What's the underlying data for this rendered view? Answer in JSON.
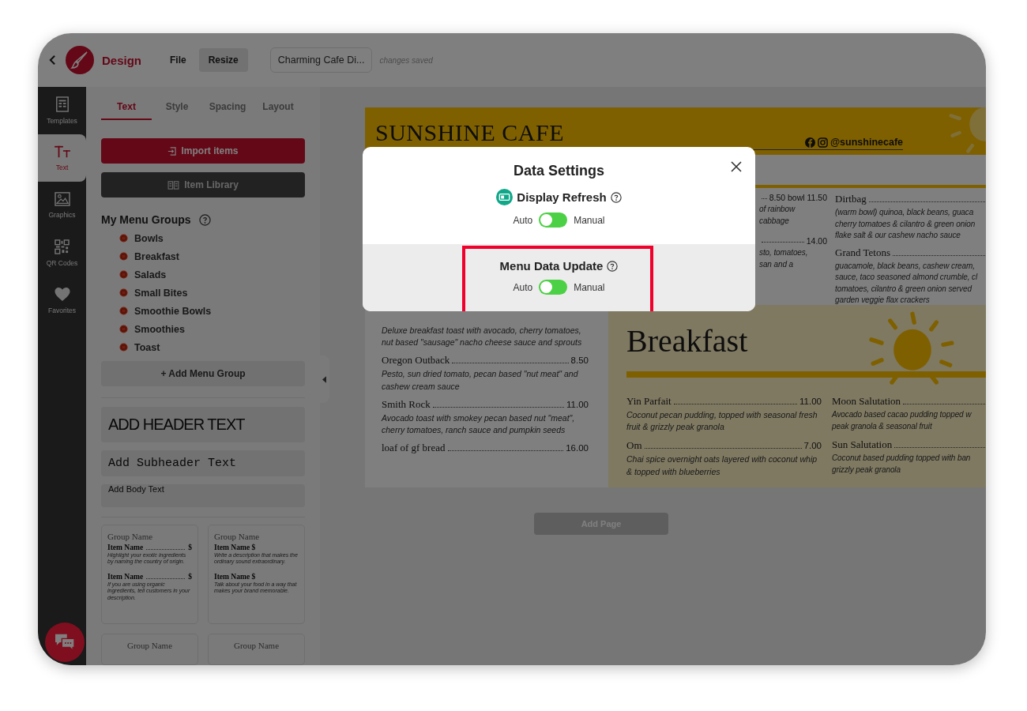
{
  "top_bar": {
    "title": "Design",
    "menu": [
      {
        "label": "File",
        "kind": "plain"
      },
      {
        "label": "Resize",
        "kind": "filled"
      }
    ],
    "document_name": "Charming Cafe Di...",
    "save_status": "changes saved"
  },
  "rail": [
    {
      "label": "Templates",
      "selected": false
    },
    {
      "label": "Text",
      "selected": true
    },
    {
      "label": "Graphics",
      "selected": false
    },
    {
      "label": "QR Codes",
      "selected": false
    },
    {
      "label": "Favorites",
      "selected": false
    }
  ],
  "panel": {
    "tabs": [
      {
        "label": "Text",
        "selected": true
      },
      {
        "label": "Style",
        "selected": false
      },
      {
        "label": "Spacing",
        "selected": false
      },
      {
        "label": "Layout",
        "selected": false
      }
    ],
    "import_button": "Import items",
    "library_button": "Item Library",
    "groups_title": "My Menu Groups",
    "groups": [
      "Bowls",
      "Breakfast",
      "Salads",
      "Small Bites",
      "Smoothie Bowls",
      "Smoothies",
      "Toast"
    ],
    "add_group": "+ Add Menu Group",
    "text_styles": [
      {
        "kind": "header",
        "label": "ADD HEADER TEXT"
      },
      {
        "kind": "subheader",
        "label": "Add Subheader Text"
      },
      {
        "kind": "body",
        "label": "Add Body Text"
      }
    ],
    "templates": [
      {
        "kind": "leader",
        "title": "Group Name",
        "items": [
          {
            "name": "Item Name",
            "price": "$",
            "description": "Highlight your exotic ingredients by naming the country of origin."
          },
          {
            "name": "Item Name",
            "price": "$",
            "description": "If you are using organic ingredients, tell customers in your description."
          }
        ]
      },
      {
        "kind": "inline",
        "title": "Group Name",
        "items": [
          {
            "name": "Item Name $",
            "description": "Write a description that makes the ordinary sound extraordinary."
          },
          {
            "name": "Item Name $",
            "description": "Talk about your food in a way that makes your brand memorable."
          }
        ]
      },
      {
        "kind": "title_only",
        "title": "Group Name"
      },
      {
        "kind": "title_only",
        "title": "Group Name"
      }
    ]
  },
  "menu": {
    "title": "SUNSHINE CAFE",
    "handle": "@sunshinecafe",
    "left_items": [
      {
        "description": "Deluxe breakfast toast with avocado, cherry tomatoes, nut based \"sausage\" nacho cheese sauce and sprouts"
      },
      {
        "name": "Oregon Outback",
        "price": "8.50",
        "description": "Pesto, sun dried tomato, pecan based \"nut meat\" and cashew cream sauce"
      },
      {
        "name": "Smith Rock",
        "price": "11.00",
        "description": "Avocado toast with smokey pecan based nut \"meat\", cherry tomatoes, ranch sauce and pumpkin seeds"
      },
      {
        "name": "loaf of gf bread",
        "price": "16.00"
      }
    ],
    "middle_fragments": [
      {
        "kind": "price",
        "text": "8.50  bowl 11.50"
      },
      {
        "kind": "text",
        "lines": [
          "of rainbow",
          "cabbage"
        ]
      },
      {
        "kind": "price",
        "text": "14.00"
      },
      {
        "kind": "text",
        "lines": [
          "sto, tomatoes,",
          "san and a"
        ]
      }
    ],
    "right_items": [
      {
        "name": "Dirtbag",
        "lines": [
          "(warm bowl) quinoa, black beans, guaca",
          "cherry tomatoes & cilantro & green onion",
          "flake salt & our cashew nacho sauce"
        ]
      },
      {
        "name": "Grand Tetons",
        "lines": [
          "guacamole, black beans, cashew cream,",
          "sauce, taco seasoned almond crumble, cl",
          "tomatoes, cilantro & green onion served",
          "garden veggie flax crackers"
        ]
      }
    ],
    "section_title": "Breakfast",
    "breakfast_left": [
      {
        "name": "Yin Parfait",
        "price": "11.00",
        "description": "Coconut pecan pudding, topped with seasonal fresh fruit & grizzly peak granola"
      },
      {
        "name": "Om",
        "price": "7.00",
        "description": "Chai spice overnight oats layered with coconut whip & topped with blueberries"
      }
    ],
    "breakfast_right": [
      {
        "name": "Moon Salutation",
        "lines": [
          "Avocado based cacao pudding topped w",
          "peak granola & seasonal fruit"
        ]
      },
      {
        "name": "Sun Salutation",
        "lines": [
          "Coconut based pudding topped with ban",
          "grizzly peak granola"
        ]
      }
    ]
  },
  "add_page": "Add Page",
  "dialog": {
    "title": "Data Settings",
    "sections": [
      {
        "kind": "with_icon",
        "title": "Display Refresh",
        "left_label": "Auto",
        "right_label": "Manual",
        "on": false,
        "highlighted": false
      },
      {
        "kind": "plain",
        "title": "Menu Data Update",
        "left_label": "Auto",
        "right_label": "Manual",
        "on": false,
        "highlighted": true
      }
    ]
  }
}
